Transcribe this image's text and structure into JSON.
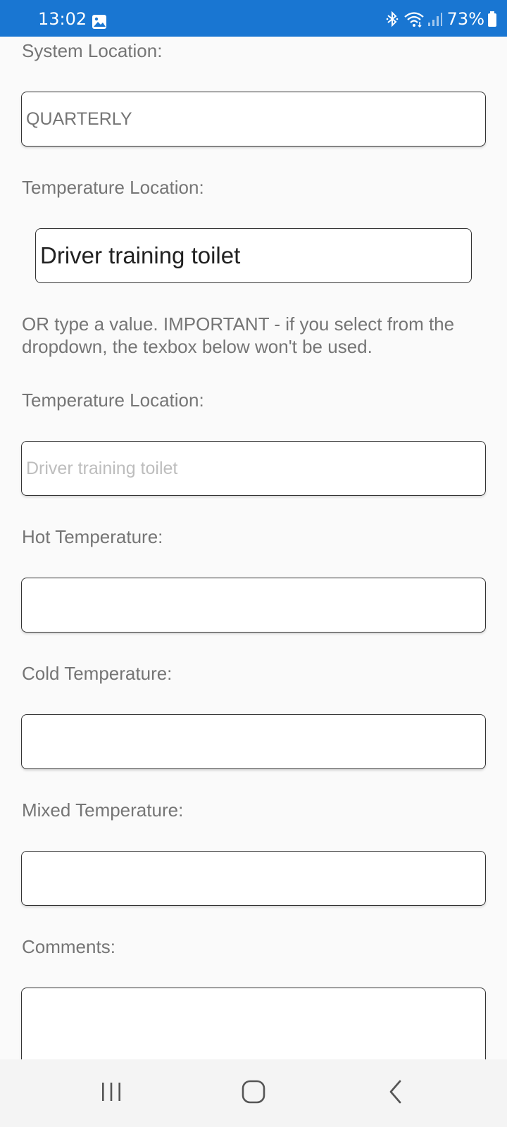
{
  "status_bar": {
    "time": "13:02",
    "battery": "73%",
    "icons": [
      "gallery-icon",
      "bluetooth-icon",
      "wifi-icon",
      "signal-icon",
      "battery-icon"
    ]
  },
  "form": {
    "system_location_label": "System Location:",
    "system_location_value": "QUARTERLY",
    "temperature_location_label": "Temperature Location:",
    "temperature_location_selected": "Driver training toilet",
    "note": "OR type a value. IMPORTANT - if you select from the dropdown, the texbox below won't be used.",
    "temperature_location_text_label": "Temperature Location:",
    "temperature_location_text_placeholder": "Driver training toilet",
    "hot_label": "Hot Temperature:",
    "hot_value": "",
    "cold_label": "Cold Temperature:",
    "cold_value": "",
    "mixed_label": "Mixed Temperature:",
    "mixed_value": "",
    "comments_label": "Comments:",
    "comments_value": ""
  },
  "nav_bar": {
    "icons": [
      "recent-apps-icon",
      "home-icon",
      "back-icon"
    ]
  },
  "colors": {
    "status_bar": "#1976d2",
    "background": "#fafafa",
    "label_text": "#757575",
    "input_border": "#333333"
  }
}
